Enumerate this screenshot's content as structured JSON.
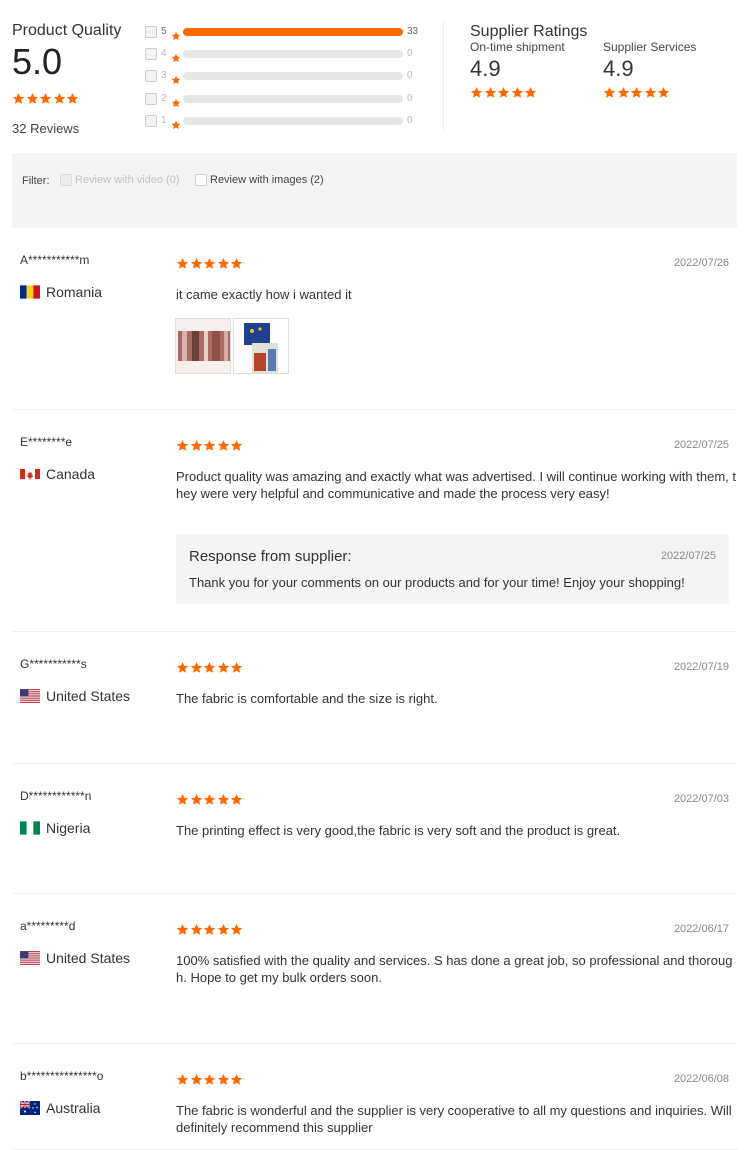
{
  "product_quality": {
    "title": "Product Quality",
    "score": "5.0",
    "rating": 5,
    "reviews_text": "32 Reviews",
    "distribution": [
      {
        "stars": "5",
        "count": "33",
        "fraction": 1.0
      },
      {
        "stars": "4",
        "count": "0",
        "fraction": 0
      },
      {
        "stars": "3",
        "count": "0",
        "fraction": 0
      },
      {
        "stars": "2",
        "count": "0",
        "fraction": 0
      },
      {
        "stars": "1",
        "count": "0",
        "fraction": 0
      }
    ]
  },
  "supplier_ratings": {
    "title": "Supplier Ratings",
    "items": [
      {
        "label": "On-time shipment",
        "score": "4.9",
        "rating": 5
      },
      {
        "label": "Supplier Services",
        "score": "4.9",
        "rating": 5
      }
    ]
  },
  "filter": {
    "label": "Filter:",
    "options": [
      {
        "label": "Review with video (0)",
        "enabled": false
      },
      {
        "label": "Review with images (2)",
        "enabled": true
      }
    ]
  },
  "colors": {
    "accent": "#ff6a00",
    "star": "#ff6a00"
  },
  "reviews": [
    {
      "name": "A***********m",
      "country": "Romania",
      "flag": "romania-flag",
      "rating": 5,
      "date": "2022/07/26",
      "text": "it came exactly how i wanted it",
      "images": [
        "fabric-photo",
        "flag-fabric-photo"
      ]
    },
    {
      "name": "E********e",
      "country": "Canada",
      "flag": "canada-flag",
      "rating": 5,
      "date": "2022/07/25",
      "text": "Product quality was amazing and exactly what was advertised. I will continue working with them, they were very helpful and communicative and made the process very easy!",
      "response": {
        "title": "Response from supplier:",
        "date": "2022/07/25",
        "text": "Thank you for your comments on our products and for your time! Enjoy your shopping!"
      }
    },
    {
      "name": "G***********s",
      "country": "United States",
      "flag": "us-flag",
      "rating": 5,
      "date": "2022/07/19",
      "text": "The fabric is comfortable and the size is right."
    },
    {
      "name": "D************n",
      "country": "Nigeria",
      "flag": "nigeria-flag",
      "rating": 5,
      "date": "2022/07/03",
      "text": "The printing effect is very good,the fabric is very soft and the product is great."
    },
    {
      "name": "a*********d",
      "country": "United States",
      "flag": "us-flag",
      "rating": 5,
      "date": "2022/06/17",
      "text": "100% satisfied with the quality and services. S        has done a great job, so professional and thorough. Hope to get my bulk orders soon."
    },
    {
      "name": "b***************o",
      "country": "Australia",
      "flag": "australia-flag",
      "rating": 5,
      "date": "2022/06/08",
      "text": "The fabric is wonderful and the supplier is very cooperative to all my questions and inquiries. Will definitely recommend this supplier"
    }
  ]
}
